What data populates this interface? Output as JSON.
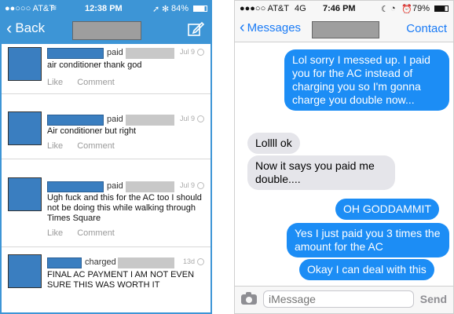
{
  "left": {
    "status": {
      "carrier": "●●○○○ AT&T",
      "time": "12:38 PM",
      "battery": "84%"
    },
    "nav": {
      "back_label": "Back"
    },
    "feed": [
      {
        "verb": "paid",
        "time": "Jul 9",
        "message": "air conditioner thank god"
      },
      {
        "verb": "paid",
        "time": "Jul 9",
        "message": "Air conditioner but right"
      },
      {
        "verb": "paid",
        "time": "Jul 9",
        "message": "Ugh fuck and this for the AC too I should not be doing this while walking through Times Square"
      },
      {
        "verb": "charged",
        "time": "13d",
        "message": "FINAL AC PAYMENT I AM NOT EVEN SURE THIS WAS WORTH IT"
      }
    ],
    "actions": {
      "like": "Like",
      "comment": "Comment"
    }
  },
  "right": {
    "status": {
      "carrier": "●●●○○ AT&T",
      "network": "4G",
      "time": "7:46 PM",
      "battery": "79%"
    },
    "nav": {
      "back_label": "Messages",
      "contact_label": "Contact"
    },
    "messages": [
      {
        "from": "me",
        "text": "Lol sorry I messed up. I paid you for the AC instead of charging you so I'm gonna charge you double now..."
      },
      {
        "from": "them",
        "text": "Lollll ok"
      },
      {
        "from": "them",
        "text": "Now it says you paid me double...."
      },
      {
        "from": "me",
        "text": "OH GODDAMMIT"
      },
      {
        "from": "me",
        "text": "Yes I just paid you 3 times the amount for the AC"
      },
      {
        "from": "me",
        "text": "Okay I can deal with this"
      }
    ],
    "composer": {
      "placeholder": "iMessage",
      "send_label": "Send"
    }
  },
  "colors": {
    "venmo_blue": "#3d95d6",
    "imessage_blue": "#1c8df5",
    "incoming_gray": "#e5e5ea"
  }
}
